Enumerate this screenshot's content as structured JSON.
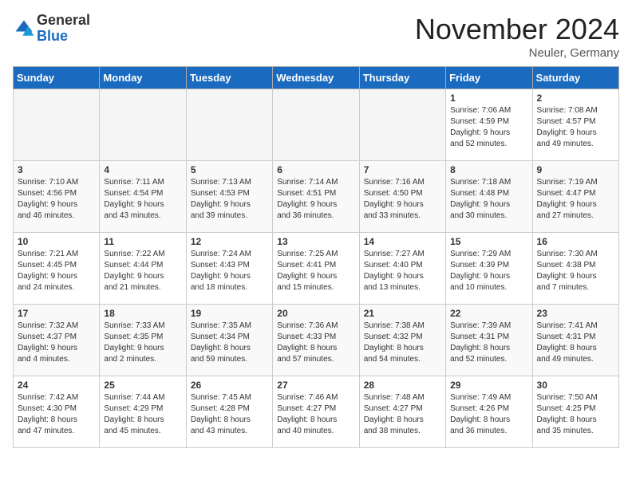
{
  "header": {
    "logo_general": "General",
    "logo_blue": "Blue",
    "month_title": "November 2024",
    "location": "Neuler, Germany"
  },
  "weekdays": [
    "Sunday",
    "Monday",
    "Tuesday",
    "Wednesday",
    "Thursday",
    "Friday",
    "Saturday"
  ],
  "weeks": [
    [
      {
        "day": "",
        "info": ""
      },
      {
        "day": "",
        "info": ""
      },
      {
        "day": "",
        "info": ""
      },
      {
        "day": "",
        "info": ""
      },
      {
        "day": "",
        "info": ""
      },
      {
        "day": "1",
        "info": "Sunrise: 7:06 AM\nSunset: 4:59 PM\nDaylight: 9 hours\nand 52 minutes."
      },
      {
        "day": "2",
        "info": "Sunrise: 7:08 AM\nSunset: 4:57 PM\nDaylight: 9 hours\nand 49 minutes."
      }
    ],
    [
      {
        "day": "3",
        "info": "Sunrise: 7:10 AM\nSunset: 4:56 PM\nDaylight: 9 hours\nand 46 minutes."
      },
      {
        "day": "4",
        "info": "Sunrise: 7:11 AM\nSunset: 4:54 PM\nDaylight: 9 hours\nand 43 minutes."
      },
      {
        "day": "5",
        "info": "Sunrise: 7:13 AM\nSunset: 4:53 PM\nDaylight: 9 hours\nand 39 minutes."
      },
      {
        "day": "6",
        "info": "Sunrise: 7:14 AM\nSunset: 4:51 PM\nDaylight: 9 hours\nand 36 minutes."
      },
      {
        "day": "7",
        "info": "Sunrise: 7:16 AM\nSunset: 4:50 PM\nDaylight: 9 hours\nand 33 minutes."
      },
      {
        "day": "8",
        "info": "Sunrise: 7:18 AM\nSunset: 4:48 PM\nDaylight: 9 hours\nand 30 minutes."
      },
      {
        "day": "9",
        "info": "Sunrise: 7:19 AM\nSunset: 4:47 PM\nDaylight: 9 hours\nand 27 minutes."
      }
    ],
    [
      {
        "day": "10",
        "info": "Sunrise: 7:21 AM\nSunset: 4:45 PM\nDaylight: 9 hours\nand 24 minutes."
      },
      {
        "day": "11",
        "info": "Sunrise: 7:22 AM\nSunset: 4:44 PM\nDaylight: 9 hours\nand 21 minutes."
      },
      {
        "day": "12",
        "info": "Sunrise: 7:24 AM\nSunset: 4:43 PM\nDaylight: 9 hours\nand 18 minutes."
      },
      {
        "day": "13",
        "info": "Sunrise: 7:25 AM\nSunset: 4:41 PM\nDaylight: 9 hours\nand 15 minutes."
      },
      {
        "day": "14",
        "info": "Sunrise: 7:27 AM\nSunset: 4:40 PM\nDaylight: 9 hours\nand 13 minutes."
      },
      {
        "day": "15",
        "info": "Sunrise: 7:29 AM\nSunset: 4:39 PM\nDaylight: 9 hours\nand 10 minutes."
      },
      {
        "day": "16",
        "info": "Sunrise: 7:30 AM\nSunset: 4:38 PM\nDaylight: 9 hours\nand 7 minutes."
      }
    ],
    [
      {
        "day": "17",
        "info": "Sunrise: 7:32 AM\nSunset: 4:37 PM\nDaylight: 9 hours\nand 4 minutes."
      },
      {
        "day": "18",
        "info": "Sunrise: 7:33 AM\nSunset: 4:35 PM\nDaylight: 9 hours\nand 2 minutes."
      },
      {
        "day": "19",
        "info": "Sunrise: 7:35 AM\nSunset: 4:34 PM\nDaylight: 8 hours\nand 59 minutes."
      },
      {
        "day": "20",
        "info": "Sunrise: 7:36 AM\nSunset: 4:33 PM\nDaylight: 8 hours\nand 57 minutes."
      },
      {
        "day": "21",
        "info": "Sunrise: 7:38 AM\nSunset: 4:32 PM\nDaylight: 8 hours\nand 54 minutes."
      },
      {
        "day": "22",
        "info": "Sunrise: 7:39 AM\nSunset: 4:31 PM\nDaylight: 8 hours\nand 52 minutes."
      },
      {
        "day": "23",
        "info": "Sunrise: 7:41 AM\nSunset: 4:31 PM\nDaylight: 8 hours\nand 49 minutes."
      }
    ],
    [
      {
        "day": "24",
        "info": "Sunrise: 7:42 AM\nSunset: 4:30 PM\nDaylight: 8 hours\nand 47 minutes."
      },
      {
        "day": "25",
        "info": "Sunrise: 7:44 AM\nSunset: 4:29 PM\nDaylight: 8 hours\nand 45 minutes."
      },
      {
        "day": "26",
        "info": "Sunrise: 7:45 AM\nSunset: 4:28 PM\nDaylight: 8 hours\nand 43 minutes."
      },
      {
        "day": "27",
        "info": "Sunrise: 7:46 AM\nSunset: 4:27 PM\nDaylight: 8 hours\nand 40 minutes."
      },
      {
        "day": "28",
        "info": "Sunrise: 7:48 AM\nSunset: 4:27 PM\nDaylight: 8 hours\nand 38 minutes."
      },
      {
        "day": "29",
        "info": "Sunrise: 7:49 AM\nSunset: 4:26 PM\nDaylight: 8 hours\nand 36 minutes."
      },
      {
        "day": "30",
        "info": "Sunrise: 7:50 AM\nSunset: 4:25 PM\nDaylight: 8 hours\nand 35 minutes."
      }
    ]
  ]
}
